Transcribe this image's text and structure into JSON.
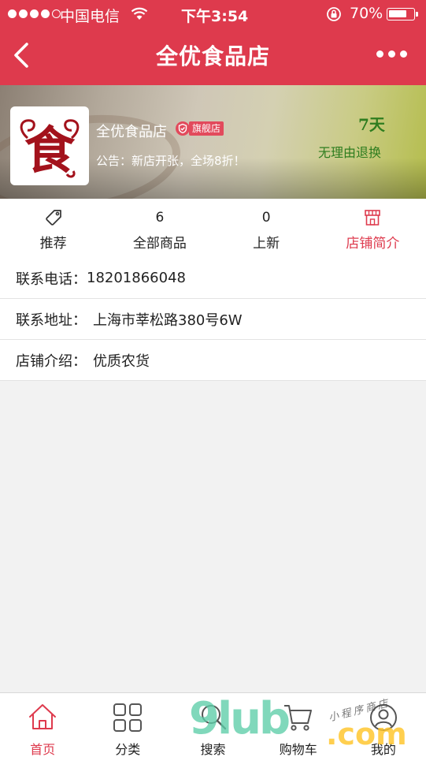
{
  "status_bar": {
    "carrier": "中国电信",
    "time": "下午3:54",
    "battery": "70%"
  },
  "nav": {
    "title": "全优食品店",
    "back_icon": "chevron-left-icon",
    "more_icon": "more-dots-icon"
  },
  "shop": {
    "logo_icon": "shop-logo-shi",
    "logo_char": "食",
    "name": "全优食品店",
    "badge": "旗舰店",
    "notice": "公告：新店开张，全场8折！",
    "promise_days": "7天",
    "promise_text": "无理由退换"
  },
  "tabs": [
    {
      "top": "",
      "icon": "tag-icon",
      "label": "推荐"
    },
    {
      "top": "6",
      "label": "全部商品"
    },
    {
      "top": "0",
      "label": "上新"
    },
    {
      "top": "",
      "icon": "store-icon",
      "label": "店铺简介",
      "active": true
    }
  ],
  "info": {
    "phone_label": "联系电话：",
    "phone": "18201866048",
    "address_label": "联系地址：",
    "address": "上海市莘松路380号6W",
    "intro_label": "店铺介绍：",
    "intro": "优质农货"
  },
  "tabbar": [
    {
      "label": "首页",
      "icon": "home-icon",
      "active": true
    },
    {
      "label": "分类",
      "icon": "grid-icon"
    },
    {
      "label": "搜索",
      "icon": "search-icon"
    },
    {
      "label": "购物车",
      "icon": "cart-icon"
    },
    {
      "label": "我的",
      "icon": "user-icon"
    }
  ],
  "watermark": {
    "main": "9lub",
    "domain": ".com",
    "tagline": "小程序商店"
  },
  "colors": {
    "brand": "#de3a4d",
    "promise": "#2e7d1f"
  }
}
